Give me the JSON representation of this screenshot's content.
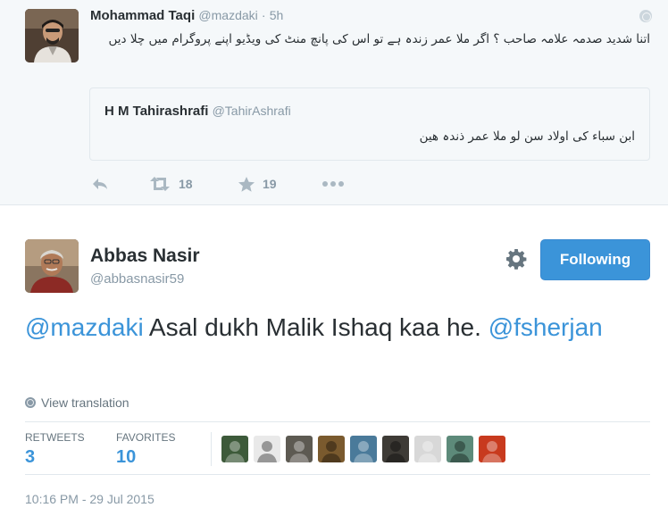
{
  "parent_tweet": {
    "name": "Mohammad Taqi",
    "handle": "@mazdaki",
    "separator": "·",
    "time": "5h",
    "text": "اتنا شدید صدمہ علامہ صاحب ؟ اگر ملا عمر زندہ ہے تو اس کی پانچ منٹ کی ویڈیو اپنے پروگرام میں چلا دیں",
    "quoted": {
      "name": "H M Tahirashrafi",
      "handle": "@TahirAshrafi",
      "text": "ابن سباء کی اولاد سن لو ملا عمر ذندہ ھین"
    },
    "actions": {
      "retweets": "18",
      "favorites": "19"
    }
  },
  "main_tweet": {
    "name": "Abbas Nasir",
    "handle": "@abbasnasir59",
    "follow_label": "Following",
    "mention_1": "@mazdaki",
    "body": " Asal dukh Malik Ishaq kaa he. ",
    "mention_2": "@fsherjan",
    "translation_label": "View translation",
    "stats": {
      "retweets_label": "RETWEETS",
      "retweets": "3",
      "favorites_label": "FAVORITES",
      "favorites": "10"
    },
    "favoriters": [
      {
        "name": "favoriter-1",
        "color": "#3d5a3a"
      },
      {
        "name": "favoriter-2",
        "color": "#e9e9e9"
      },
      {
        "name": "favoriter-3",
        "color": "#5d5a52"
      },
      {
        "name": "favoriter-4",
        "color": "#7a5a2e"
      },
      {
        "name": "favoriter-5",
        "color": "#4a7a9a"
      },
      {
        "name": "favoriter-6",
        "color": "#3e3b36"
      },
      {
        "name": "favoriter-7",
        "color": "#d8d8d8"
      },
      {
        "name": "favoriter-8",
        "color": "#5d8a7a"
      },
      {
        "name": "favoriter-9",
        "color": "#c83a1e"
      }
    ],
    "timestamp": "10:16 PM - 29 Jul 2015"
  },
  "colors": {
    "accent": "#3b94d9",
    "muted": "#8899a6",
    "text": "#292f33",
    "parent_bg": "#f5f8fa"
  }
}
